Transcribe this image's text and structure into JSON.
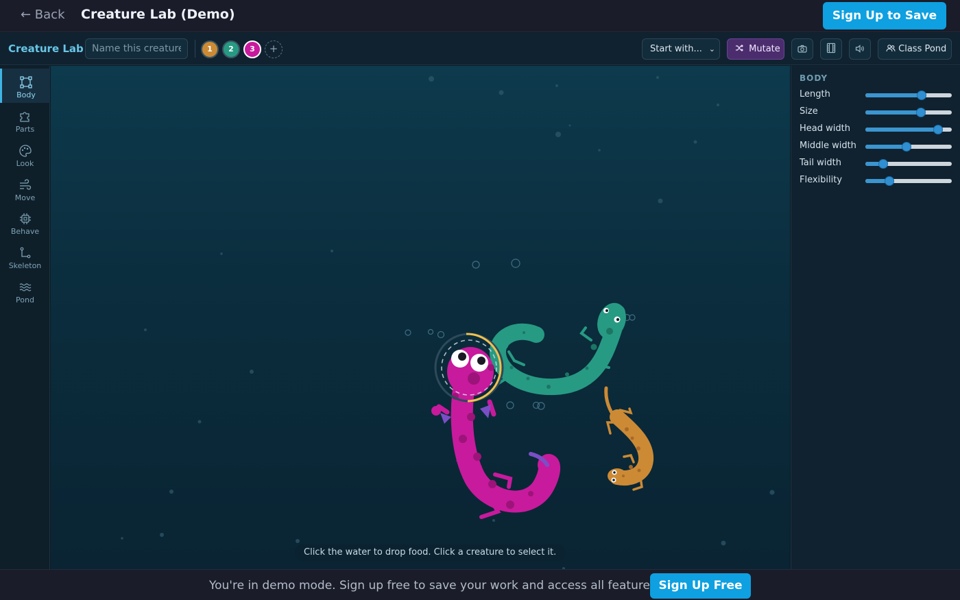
{
  "header": {
    "back_label": "← Back",
    "title": "Creature Lab (Demo)",
    "signup_save_label": "Sign Up to Save"
  },
  "toolbar": {
    "brand": "Creature Lab",
    "name_placeholder": "Name this creature",
    "name_value": "",
    "slots": [
      "1",
      "2",
      "3"
    ],
    "active_slot": "3",
    "slot_colors": [
      "#cc8a35",
      "#279a83",
      "#c81a9d"
    ],
    "add_slot_label": "+",
    "start_with_label": "Start with...",
    "mutate_label": "Mutate",
    "class_pond_label": "Class Pond",
    "icons": [
      "camera-icon",
      "film-icon",
      "sound-icon",
      "people-icon",
      "shuffle-icon"
    ]
  },
  "sidebar": {
    "items": [
      {
        "label": "Body",
        "icon": "body-frame-icon",
        "active": true
      },
      {
        "label": "Parts",
        "icon": "puzzle-icon",
        "active": false
      },
      {
        "label": "Look",
        "icon": "palette-icon",
        "active": false
      },
      {
        "label": "Move",
        "icon": "wind-icon",
        "active": false
      },
      {
        "label": "Behave",
        "icon": "chip-icon",
        "active": false
      },
      {
        "label": "Skeleton",
        "icon": "skeleton-icon",
        "active": false
      },
      {
        "label": "Pond",
        "icon": "waves-icon",
        "active": false
      }
    ]
  },
  "pond": {
    "hint": "Click the water to drop food. Click a creature to select it.",
    "creatures": [
      {
        "color": "#c81a9d",
        "selected": true
      },
      {
        "color": "#279a83",
        "selected": false
      },
      {
        "color": "#cc8a35",
        "selected": false
      }
    ]
  },
  "panel": {
    "title": "BODY",
    "params": [
      {
        "label": "Length",
        "value": 0.65
      },
      {
        "label": "Size",
        "value": 0.64
      },
      {
        "label": "Head width",
        "value": 0.84
      },
      {
        "label": "Middle width",
        "value": 0.48
      },
      {
        "label": "Tail width",
        "value": 0.21
      },
      {
        "label": "Flexibility",
        "value": 0.28
      }
    ]
  },
  "banner": {
    "text": "You're in demo mode. Sign up free to save your work and access all features.",
    "signup_free_label": "Sign Up Free"
  },
  "colors": {
    "accent": "#0ea0e0",
    "mutate": "#4b2d6e",
    "selection_ring": "#f2c14e"
  }
}
